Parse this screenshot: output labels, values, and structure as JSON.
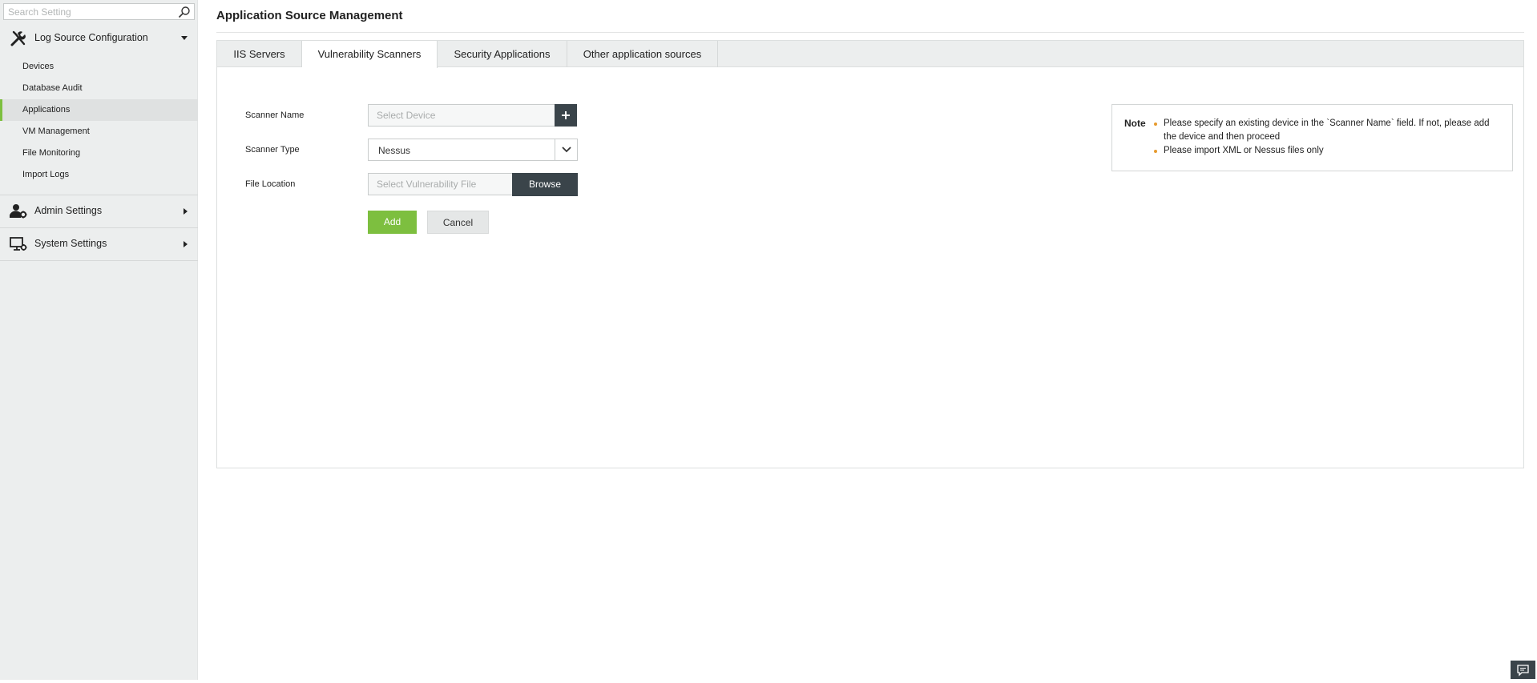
{
  "sidebar": {
    "search": {
      "placeholder": "Search Setting",
      "value": ""
    },
    "sections": [
      {
        "label": "Log Source Configuration",
        "icon": "tools-icon",
        "expanded": true
      },
      {
        "label": "Admin Settings",
        "icon": "user-gear-icon",
        "expanded": false
      },
      {
        "label": "System Settings",
        "icon": "monitor-gear-icon",
        "expanded": false
      }
    ],
    "items": [
      {
        "label": "Devices"
      },
      {
        "label": "Database Audit"
      },
      {
        "label": "Applications",
        "active": true
      },
      {
        "label": "VM Management"
      },
      {
        "label": "File Monitoring"
      },
      {
        "label": "Import Logs"
      }
    ]
  },
  "main": {
    "title": "Application Source Management",
    "tabs": [
      {
        "label": "IIS Servers"
      },
      {
        "label": "Vulnerability Scanners",
        "active": true
      },
      {
        "label": "Security Applications"
      },
      {
        "label": "Other application sources"
      }
    ],
    "form": {
      "scanner_name": {
        "label": "Scanner Name",
        "placeholder": "Select Device",
        "value": ""
      },
      "scanner_type": {
        "label": "Scanner Type",
        "value": "Nessus"
      },
      "file_location": {
        "label": "File Location",
        "placeholder": "Select Vulnerability File",
        "browse_label": "Browse"
      },
      "add_label": "Add",
      "cancel_label": "Cancel"
    },
    "note": {
      "title": "Note",
      "items": [
        "Please specify an existing device in the `Scanner Name` field. If not, please add the device and then proceed",
        "Please import XML or Nessus files only"
      ]
    }
  },
  "colors": {
    "accent": "#7dbf3f",
    "dark": "#3a444a",
    "sidebar_bg": "#eceeee",
    "bullet": "#e69a2e"
  }
}
